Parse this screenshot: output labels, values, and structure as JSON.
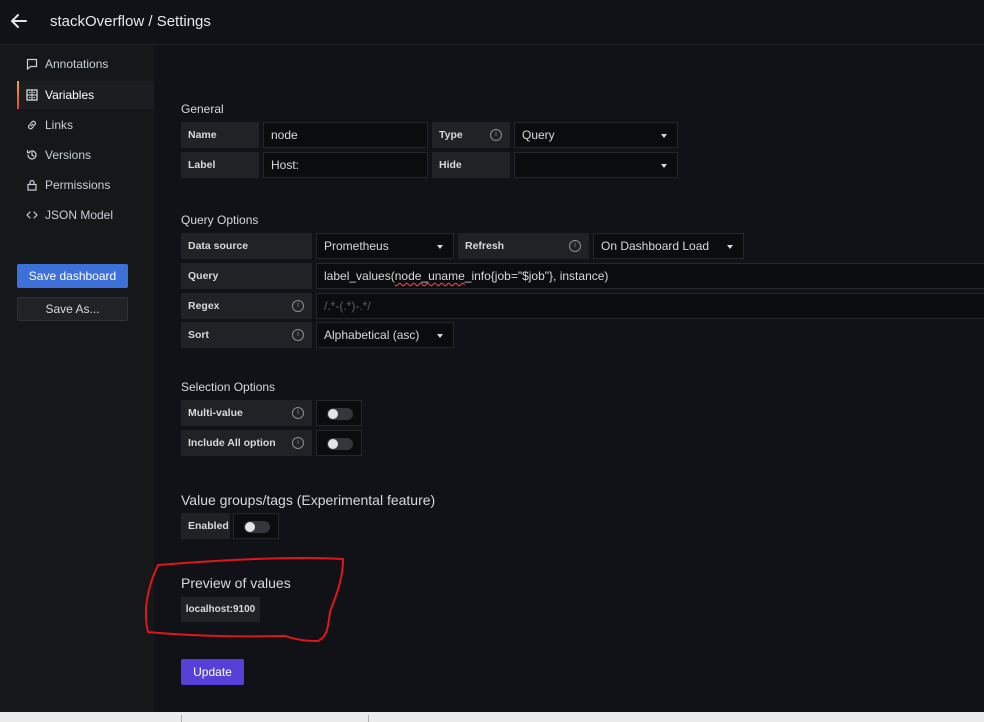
{
  "header": {
    "title": "stackOverflow / Settings"
  },
  "sidebar": {
    "items": [
      {
        "label": "Annotations",
        "icon": "comment-icon",
        "active": false
      },
      {
        "label": "Variables",
        "icon": "calculator-icon",
        "active": true
      },
      {
        "label": "Links",
        "icon": "link-icon",
        "active": false
      },
      {
        "label": "Versions",
        "icon": "history-icon",
        "active": false
      },
      {
        "label": "Permissions",
        "icon": "lock-icon",
        "active": false
      },
      {
        "label": "JSON Model",
        "icon": "code-icon",
        "active": false
      }
    ],
    "save_label": "Save dashboard",
    "save_as_label": "Save As..."
  },
  "general": {
    "title": "General",
    "name_label": "Name",
    "name_value": "node",
    "type_label": "Type",
    "type_value": "Query",
    "label_label": "Label",
    "label_value": "Host:",
    "hide_label": "Hide",
    "hide_value": ""
  },
  "query_options": {
    "title": "Query Options",
    "datasource_label": "Data source",
    "datasource_value": "Prometheus",
    "refresh_label": "Refresh",
    "refresh_value": "On Dashboard Load",
    "query_label": "Query",
    "query_prefix": "label_values(",
    "query_underlined": "node_uname",
    "query_suffix": "_info{job=\"$job\"}, instance)",
    "regex_label": "Regex",
    "regex_placeholder": "/.*-(.*)-.*/",
    "sort_label": "Sort",
    "sort_value": "Alphabetical (asc)"
  },
  "selection_options": {
    "title": "Selection Options",
    "multi_label": "Multi-value",
    "multi_on": false,
    "include_all_label": "Include All option",
    "include_all_on": false
  },
  "value_groups": {
    "title": "Value groups/tags (Experimental feature)",
    "enabled_label": "Enabled",
    "enabled_on": false
  },
  "preview": {
    "title": "Preview of values",
    "values": [
      "localhost:9100"
    ]
  },
  "update_label": "Update",
  "colors": {
    "background": "#111217",
    "sidebar": "#161719",
    "primary_button": "#3d71d9",
    "update_button": "#5740d8",
    "annotation_ink": "#e0161b"
  }
}
